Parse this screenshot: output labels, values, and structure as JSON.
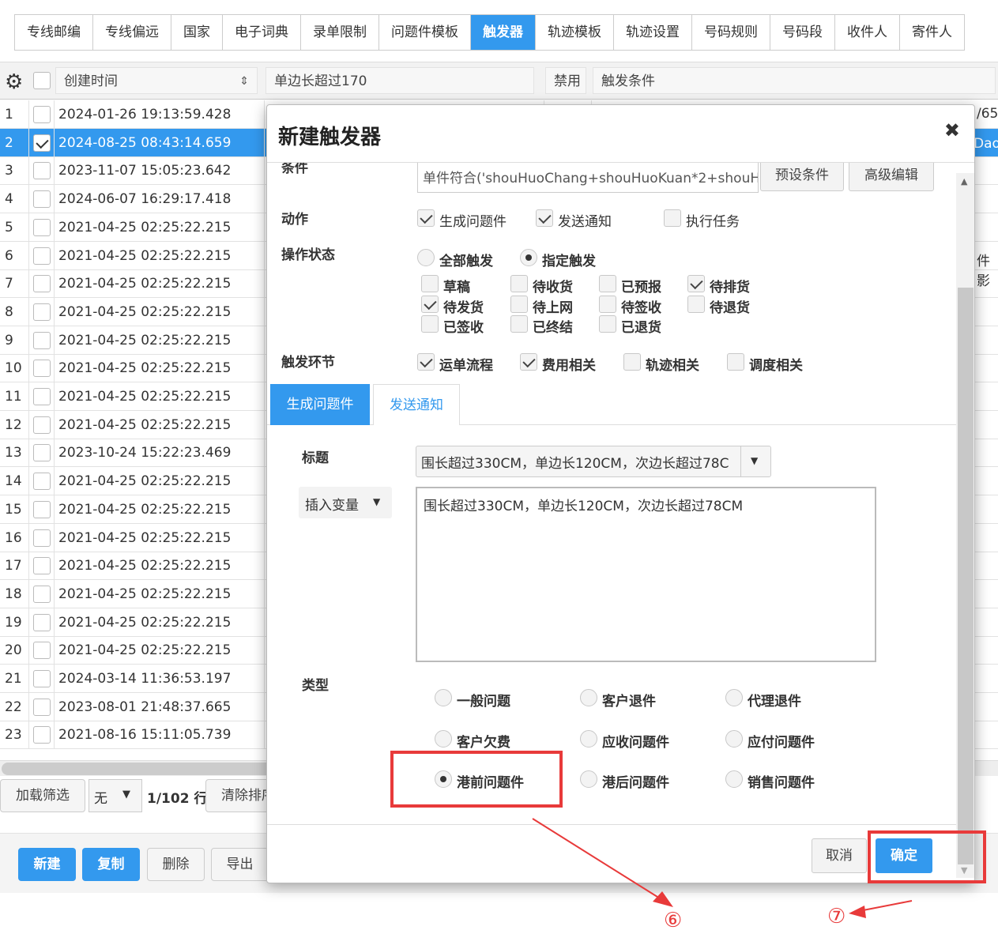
{
  "tabs": [
    "专线邮编",
    "专线偏远",
    "国家",
    "电子词典",
    "录单限制",
    "问题件模板",
    "触发器",
    "轨迹模板",
    "轨迹设置",
    "号码规则",
    "号码段",
    "收件人",
    "寄件人"
  ],
  "active_tab": "触发器",
  "grid": {
    "headers": {
      "created": "创建时间",
      "cond_value": "单边长超过170",
      "disabled": "禁用",
      "trigger_cond": "触发条件"
    },
    "rows": [
      {
        "n": "1",
        "date": "2024-01-26 19:13:59.428",
        "checked": false
      },
      {
        "n": "2",
        "date": "2024-08-25 08:43:14.659",
        "checked": true
      },
      {
        "n": "3",
        "date": "2023-11-07 15:05:23.642",
        "checked": false
      },
      {
        "n": "4",
        "date": "2024-06-07 16:29:17.418",
        "checked": false
      },
      {
        "n": "5",
        "date": "2021-04-25 02:25:22.215",
        "checked": false
      },
      {
        "n": "6",
        "date": "2021-04-25 02:25:22.215",
        "checked": false
      },
      {
        "n": "7",
        "date": "2021-04-25 02:25:22.215",
        "checked": false
      },
      {
        "n": "8",
        "date": "2021-04-25 02:25:22.215",
        "checked": false
      },
      {
        "n": "9",
        "date": "2021-04-25 02:25:22.215",
        "checked": false
      },
      {
        "n": "10",
        "date": "2021-04-25 02:25:22.215",
        "checked": false
      },
      {
        "n": "11",
        "date": "2021-04-25 02:25:22.215",
        "checked": false
      },
      {
        "n": "12",
        "date": "2021-04-25 02:25:22.215",
        "checked": false
      },
      {
        "n": "13",
        "date": "2023-10-24 15:22:23.469",
        "checked": false
      },
      {
        "n": "14",
        "date": "2021-04-25 02:25:22.215",
        "checked": false
      },
      {
        "n": "15",
        "date": "2021-04-25 02:25:22.215",
        "checked": false
      },
      {
        "n": "16",
        "date": "2021-04-25 02:25:22.215",
        "checked": false
      },
      {
        "n": "17",
        "date": "2021-04-25 02:25:22.215",
        "checked": false
      },
      {
        "n": "18",
        "date": "2021-04-25 02:25:22.215",
        "checked": false
      },
      {
        "n": "19",
        "date": "2021-04-25 02:25:22.215",
        "checked": false
      },
      {
        "n": "20",
        "date": "2021-04-25 02:25:22.215",
        "checked": false
      },
      {
        "n": "21",
        "date": "2024-03-14 11:36:53.197",
        "checked": false
      },
      {
        "n": "22",
        "date": "2023-08-01 21:48:37.665",
        "checked": false
      },
      {
        "n": "23",
        "date": "2021-08-16 15:11:05.739",
        "checked": false
      }
    ],
    "right_fragments": {
      "r1": "/65'",
      "r2": "Dao",
      "r6": "件影"
    }
  },
  "pager": {
    "load_filter": "加载筛选",
    "filter_value": "无",
    "page_info": "1/102 行",
    "clear_sort": "清除排序"
  },
  "actions": {
    "new": "新建",
    "copy": "复制",
    "delete": "删除",
    "export": "导出"
  },
  "modal": {
    "title": "新建触发器",
    "close": "✖",
    "cond_label_partial": "条件",
    "cond_value": "单件符合('shouHuoChang+shouHuoKuan*2+shouHu",
    "preset_btn": "预设条件",
    "advanced_btn": "高级编辑",
    "action_label": "动作",
    "actions": [
      {
        "label": "生成问题件",
        "checked": true
      },
      {
        "label": "发送通知",
        "checked": true
      },
      {
        "label": "执行任务",
        "checked": false
      }
    ],
    "op_state_label": "操作状态",
    "op_state_modes": [
      {
        "label": "全部触发",
        "checked": false
      },
      {
        "label": "指定触发",
        "checked": true
      }
    ],
    "states": [
      {
        "label": "草稿",
        "checked": false
      },
      {
        "label": "待收货",
        "checked": false
      },
      {
        "label": "已预报",
        "checked": false
      },
      {
        "label": "待排货",
        "checked": true
      },
      {
        "label": "待发货",
        "checked": true
      },
      {
        "label": "待上网",
        "checked": false
      },
      {
        "label": "待签收",
        "checked": false
      },
      {
        "label": "待退货",
        "checked": false
      },
      {
        "label": "已签收",
        "checked": false
      },
      {
        "label": "已终结",
        "checked": false
      },
      {
        "label": "已退货",
        "checked": false
      }
    ],
    "stage_label": "触发环节",
    "stages": [
      {
        "label": "运单流程",
        "checked": true
      },
      {
        "label": "费用相关",
        "checked": true
      },
      {
        "label": "轨迹相关",
        "checked": false
      },
      {
        "label": "调度相关",
        "checked": false
      }
    ],
    "subtabs": [
      "生成问题件",
      "发送通知"
    ],
    "title_label": "标题",
    "title_value": "围长超过330CM，单边长120CM，次边长超过78C",
    "insert_var": "插入变量",
    "content": "围长超过330CM，单边长120CM，次边长超过78CM",
    "type_label": "类型",
    "types": [
      {
        "label": "一般问题",
        "checked": false
      },
      {
        "label": "客户退件",
        "checked": false
      },
      {
        "label": "代理退件",
        "checked": false
      },
      {
        "label": "客户欠费",
        "checked": false
      },
      {
        "label": "应收问题件",
        "checked": false
      },
      {
        "label": "应付问题件",
        "checked": false
      },
      {
        "label": "港前问题件",
        "checked": true
      },
      {
        "label": "港后问题件",
        "checked": false
      },
      {
        "label": "销售问题件",
        "checked": false
      }
    ],
    "cancel": "取消",
    "ok": "确定"
  },
  "annotations": {
    "step6": "⑥",
    "step7": "⑦",
    "color": "#e83a3a"
  }
}
